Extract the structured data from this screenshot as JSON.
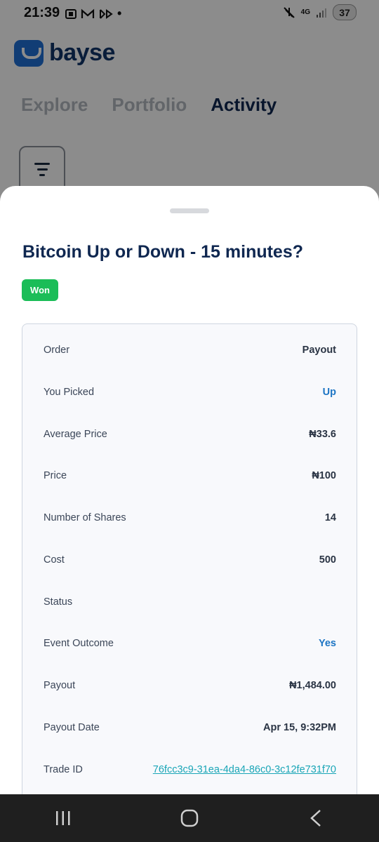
{
  "status_bar": {
    "time": "21:39",
    "network": "4G",
    "battery": "37"
  },
  "app": {
    "brand": "bayse",
    "tabs": [
      {
        "label": "Explore"
      },
      {
        "label": "Portfolio"
      },
      {
        "label": "Activity"
      }
    ],
    "active_tab": "Activity"
  },
  "sheet": {
    "title": "Bitcoin Up or Down - 15 minutes?",
    "badge": "Won",
    "rows": [
      {
        "label": "Order",
        "value": "Payout"
      },
      {
        "label": "You Picked",
        "value": "Up"
      },
      {
        "label": "Average Price",
        "value": "₦33.6"
      },
      {
        "label": "Price",
        "value": "₦100"
      },
      {
        "label": "Number of Shares",
        "value": "14"
      },
      {
        "label": "Cost",
        "value": "500"
      },
      {
        "label": "Status",
        "value": ""
      },
      {
        "label": "Event Outcome",
        "value": "Yes"
      },
      {
        "label": "Payout",
        "value": "₦1,484.00"
      },
      {
        "label": "Payout Date",
        "value": "Apr 15, 9:32PM"
      },
      {
        "label": "Trade ID",
        "value": "76fcc3c9-31ea-4da4-86c0-3c12fe731f70"
      }
    ]
  },
  "colors": {
    "brand_blue": "#1f6fd6",
    "navy": "#0f2750",
    "won_green": "#1bbd58",
    "accent_blue": "#1d75c4",
    "link_teal": "#1aa6b7"
  }
}
